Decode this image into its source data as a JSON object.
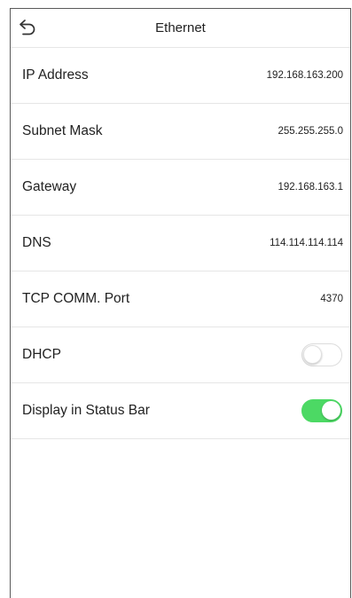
{
  "header": {
    "title": "Ethernet"
  },
  "icons": {
    "back": "back-arrow-icon"
  },
  "colors": {
    "toggle_on": "#4cd964",
    "toggle_off_border": "#dcdcdc",
    "divider": "#e6e6e6"
  },
  "settings": [
    {
      "label": "IP Address",
      "value": "192.168.163.200"
    },
    {
      "label": "Subnet Mask",
      "value": "255.255.255.0"
    },
    {
      "label": "Gateway",
      "value": "192.168.163.1"
    },
    {
      "label": "DNS",
      "value": "114.114.114.114"
    },
    {
      "label": "TCP COMM. Port",
      "value": "4370"
    }
  ],
  "toggles": [
    {
      "label": "DHCP",
      "enabled": false
    },
    {
      "label": "Display in Status Bar",
      "enabled": true
    }
  ]
}
